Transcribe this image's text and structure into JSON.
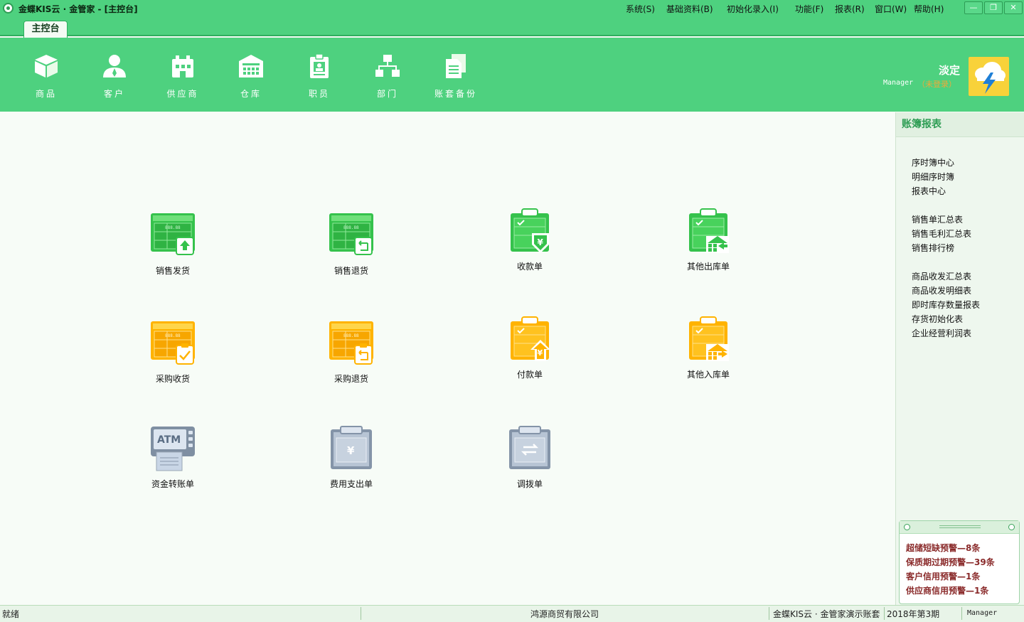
{
  "window": {
    "title": "金蝶KIS云 · 金管家 - [主控台]",
    "buttons": {
      "minimize": "—",
      "restore": "❐",
      "close": "✕"
    }
  },
  "menu": [
    "系统(S)",
    "基础资料(B)",
    "初始化录入(I)",
    "功能(F)",
    "报表(R)",
    "窗口(W)",
    "帮助(H)"
  ],
  "tab": {
    "label": "主控台"
  },
  "toolbar": [
    {
      "label": "商品",
      "icon": "box-icon"
    },
    {
      "label": "客户",
      "icon": "user-icon"
    },
    {
      "label": "供应商",
      "icon": "supplier-icon"
    },
    {
      "label": "仓库",
      "icon": "warehouse-icon"
    },
    {
      "label": "职员",
      "icon": "employee-badge-icon"
    },
    {
      "label": "部门",
      "icon": "org-chart-icon"
    },
    {
      "label": "账套备份",
      "icon": "document-backup-icon"
    }
  ],
  "user": {
    "name": "淡定",
    "role": "Manager",
    "status": "（未登录）"
  },
  "tiles": [
    {
      "label": "销售发货",
      "icon": "sales-delivery-icon",
      "color": "green"
    },
    {
      "label": "销售退货",
      "icon": "sales-return-icon",
      "color": "green"
    },
    {
      "label": "收款单",
      "icon": "receipt-icon",
      "color": "green"
    },
    {
      "label": "其他出库单",
      "icon": "other-outbound-icon",
      "color": "green"
    },
    {
      "label": "采购收货",
      "icon": "purchase-receive-icon",
      "color": "orange"
    },
    {
      "label": "采购退货",
      "icon": "purchase-return-icon",
      "color": "orange"
    },
    {
      "label": "付款单",
      "icon": "payment-icon",
      "color": "orange"
    },
    {
      "label": "其他入库单",
      "icon": "other-inbound-icon",
      "color": "orange"
    },
    {
      "label": "资金转账单",
      "icon": "atm-transfer-icon",
      "color": "gray"
    },
    {
      "label": "费用支出单",
      "icon": "expense-icon",
      "color": "gray"
    },
    {
      "label": "调拨单",
      "icon": "transfer-icon",
      "color": "gray"
    }
  ],
  "tile_text": {
    "grid_number": "888.88",
    "atm": "ATM",
    "yuan": "¥"
  },
  "sidebar": {
    "title": "账簿报表",
    "groups": [
      [
        "序时簿中心",
        "明细序时簿",
        "报表中心"
      ],
      [
        "销售单汇总表",
        "销售毛利汇总表",
        "销售排行榜"
      ],
      [
        "商品收发汇总表",
        "商品收发明细表",
        "即时库存数量报表",
        "存货初始化表",
        "企业经营利润表"
      ]
    ]
  },
  "alerts": [
    "超储短缺预警—8条",
    "保质期过期预警—39条",
    "客户信用预警—1条",
    "供应商信用预警—1条"
  ],
  "statusbar": {
    "status": "就绪",
    "company": "鸿源商贸有限公司",
    "account": "金蝶KIS云 · 金管家演示账套",
    "period": "2018年第3期",
    "user": "Manager"
  },
  "colors": {
    "brand_green": "#4ed17f",
    "tile_green": "#35c24c",
    "tile_orange": "#ffb300",
    "tile_gray": "#9aa7b6",
    "alert_text": "#8a2a2a",
    "avatar": "#f8d23a"
  }
}
